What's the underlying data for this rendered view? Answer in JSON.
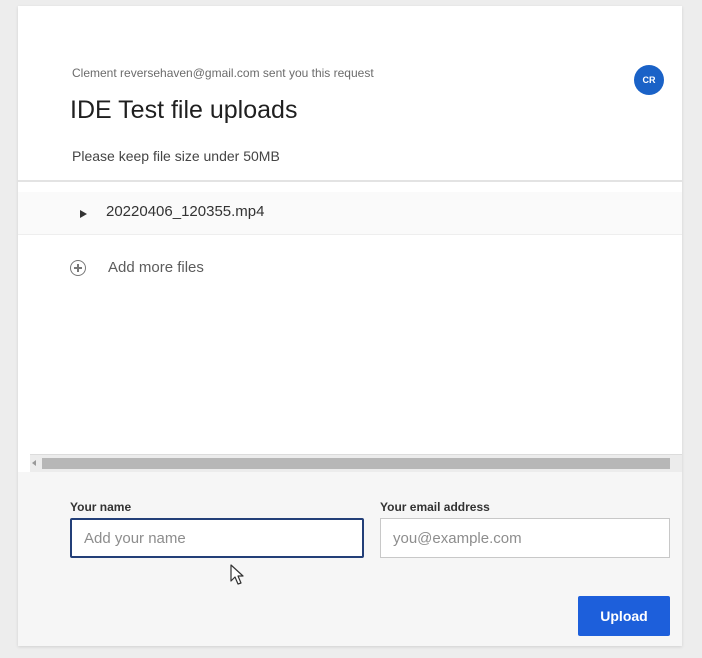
{
  "header": {
    "sender_text": "Clement reversehaven@gmail.com sent you this request",
    "title": "IDE Test file uploads",
    "subtitle": "Please keep file size under 50MB",
    "avatar_initials": "CR"
  },
  "files": {
    "items": [
      {
        "name": "20220406_120355.mp4"
      }
    ],
    "add_more_label": "Add more files"
  },
  "form": {
    "name_label": "Your name",
    "name_placeholder": "Add your name",
    "email_label": "Your email address",
    "email_placeholder": "you@example.com",
    "upload_label": "Upload"
  },
  "colors": {
    "accent": "#1d5fdb",
    "avatar": "#1a62c7",
    "focus_border": "#233f78"
  },
  "icons": [
    "play-icon",
    "add-circle-icon",
    "cursor-icon",
    "scroll-left-arrow-icon",
    "scroll-right-arrow-icon"
  ]
}
